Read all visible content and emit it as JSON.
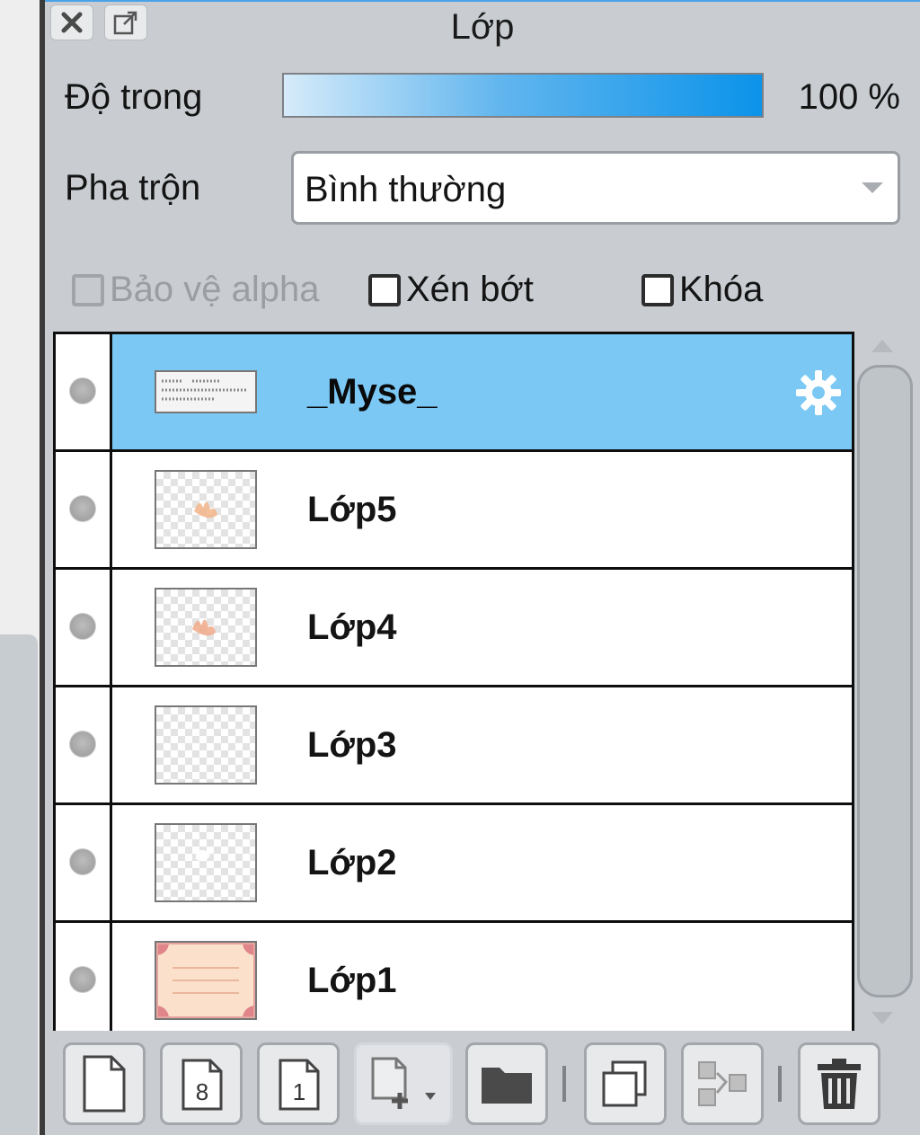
{
  "panel": {
    "title": "Lớp"
  },
  "opacity": {
    "label": "Độ trong",
    "value_text": "100 %",
    "value": 100
  },
  "blend": {
    "label": "Pha trộn",
    "selected": "Bình thường"
  },
  "checks": {
    "protect_alpha": "Bảo vệ alpha",
    "clipping": "Xén bớt",
    "lock": "Khóa"
  },
  "layers": [
    {
      "name": "_Myse_",
      "selected": true
    },
    {
      "name": "Lớp5",
      "selected": false
    },
    {
      "name": "Lớp4",
      "selected": false
    },
    {
      "name": "Lớp3",
      "selected": false
    },
    {
      "name": "Lớp2",
      "selected": false
    },
    {
      "name": "Lớp1",
      "selected": false
    }
  ],
  "toolbar": {
    "icons": [
      "new-layer-icon",
      "new-8bit-layer-icon",
      "new-1bit-layer-icon",
      "add-layer-menu-icon",
      "new-folder-icon",
      "duplicate-layer-icon",
      "merge-down-icon",
      "delete-layer-icon"
    ]
  },
  "colors": {
    "selected_row": "#7bc8f4",
    "panel_bg": "#c9cdd2",
    "opacity_end": "#0b93ea"
  }
}
